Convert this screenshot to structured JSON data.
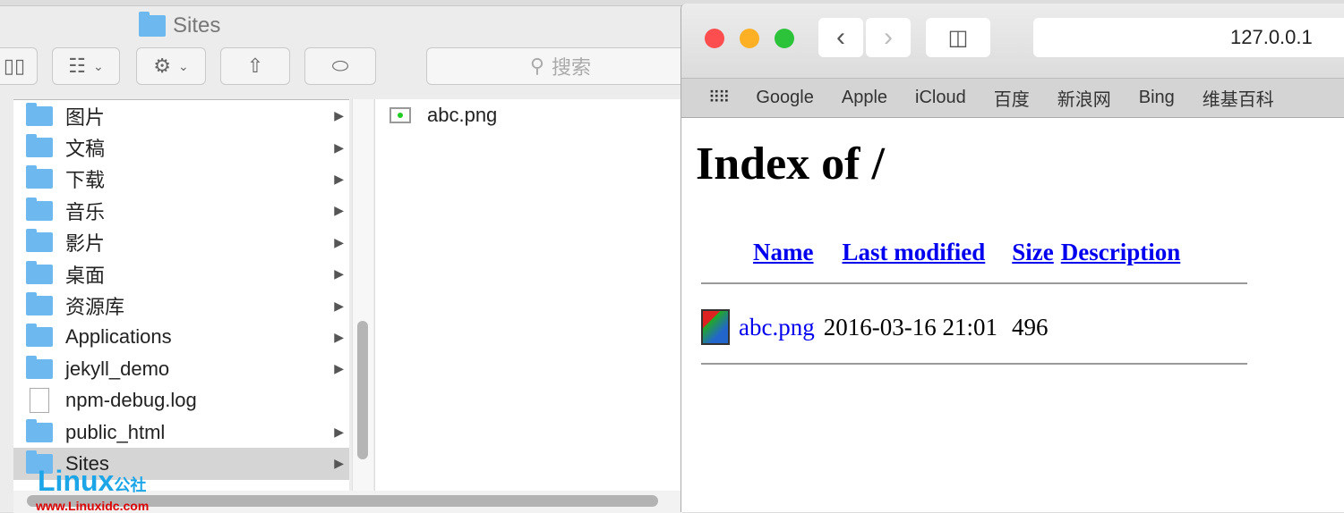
{
  "finder": {
    "title": "Sites",
    "search_placeholder": "搜索",
    "items": [
      {
        "label": "图片",
        "type": "folder",
        "arrow": true
      },
      {
        "label": "文稿",
        "type": "folder",
        "arrow": true
      },
      {
        "label": "下载",
        "type": "folder",
        "arrow": true
      },
      {
        "label": "音乐",
        "type": "folder",
        "arrow": true
      },
      {
        "label": "影片",
        "type": "folder",
        "arrow": true
      },
      {
        "label": "桌面",
        "type": "folder",
        "arrow": true
      },
      {
        "label": "资源库",
        "type": "folder",
        "arrow": true
      },
      {
        "label": "Applications",
        "type": "folder",
        "arrow": true
      },
      {
        "label": "jekyll_demo",
        "type": "folder",
        "arrow": true
      },
      {
        "label": "npm-debug.log",
        "type": "file",
        "arrow": false
      },
      {
        "label": "public_html",
        "type": "folder",
        "arrow": true
      },
      {
        "label": "Sites",
        "type": "folder",
        "arrow": true,
        "selected": true
      }
    ],
    "column2": [
      {
        "label": "abc.png"
      }
    ]
  },
  "browser": {
    "url": "127.0.0.1",
    "bookmarks": [
      "Google",
      "Apple",
      "iCloud",
      "百度",
      "新浪网",
      "Bing",
      "维基百科"
    ],
    "page": {
      "title": "Index of /",
      "headers": [
        "Name",
        "Last modified",
        "Size",
        "Description"
      ],
      "rows": [
        {
          "name": "abc.png",
          "modified": "2016-03-16 21:01",
          "size": "496",
          "description": ""
        }
      ]
    }
  },
  "watermark": {
    "text": "Linux公社",
    "url": "www.Linuxidc.com"
  },
  "colors": {
    "close": "#fc4e4f",
    "minimize": "#fdb023",
    "zoom": "#2cc33b",
    "link": "#0000ee",
    "folder": "#6cb8ef"
  }
}
